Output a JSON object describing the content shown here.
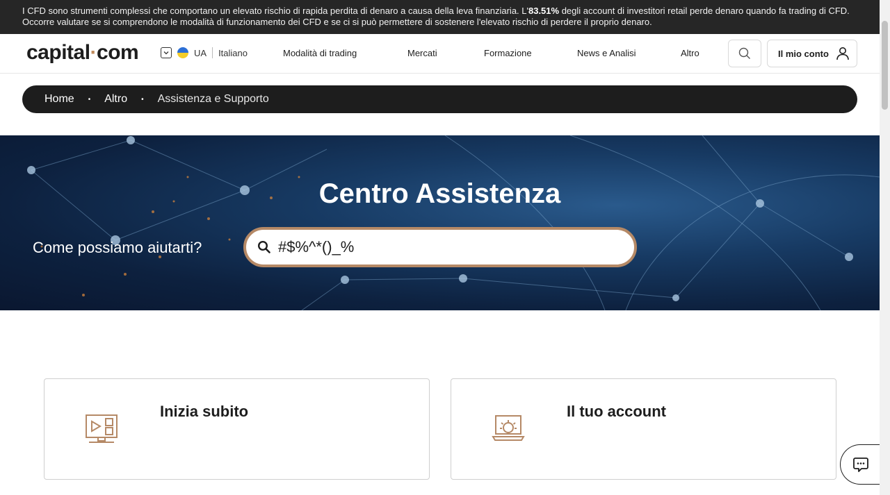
{
  "risk_banner": {
    "text_before": "I CFD sono strumenti complessi che comportano un elevato rischio di rapida perdita di denaro a causa della leva finanziaria. L'",
    "percentage": "83.51%",
    "text_after": " degli account di investitori retail perde denaro quando fa trading di CFD. Occorre valutare se si comprendono le modalità di funzionamento dei CFD e se ci si può permettere di sostenere l'elevato rischio di perdere il proprio denaro."
  },
  "header": {
    "logo_left": "capital",
    "logo_dot": "·",
    "logo_right": "com",
    "region": "UA",
    "language": "Italiano",
    "nav": [
      "Modalità di trading",
      "Mercati",
      "Formazione",
      "News e Analisi",
      "Altro"
    ],
    "account_label": "Il mio conto"
  },
  "breadcrumb": {
    "items": [
      "Home",
      "Altro",
      "Assistenza e Supporto"
    ],
    "separator": "•"
  },
  "hero": {
    "title": "Centro Assistenza",
    "search_label": "Come possiamo aiutarti?",
    "search_value": "#$%^*()_%"
  },
  "cards": [
    {
      "title": "Inizia subito",
      "icon": "monitor-play-icon"
    },
    {
      "title": "Il tuo account",
      "icon": "laptop-gear-icon"
    }
  ],
  "colors": {
    "accent": "#b58966",
    "dark": "#1d1d1d",
    "banner_bg": "#262626"
  }
}
